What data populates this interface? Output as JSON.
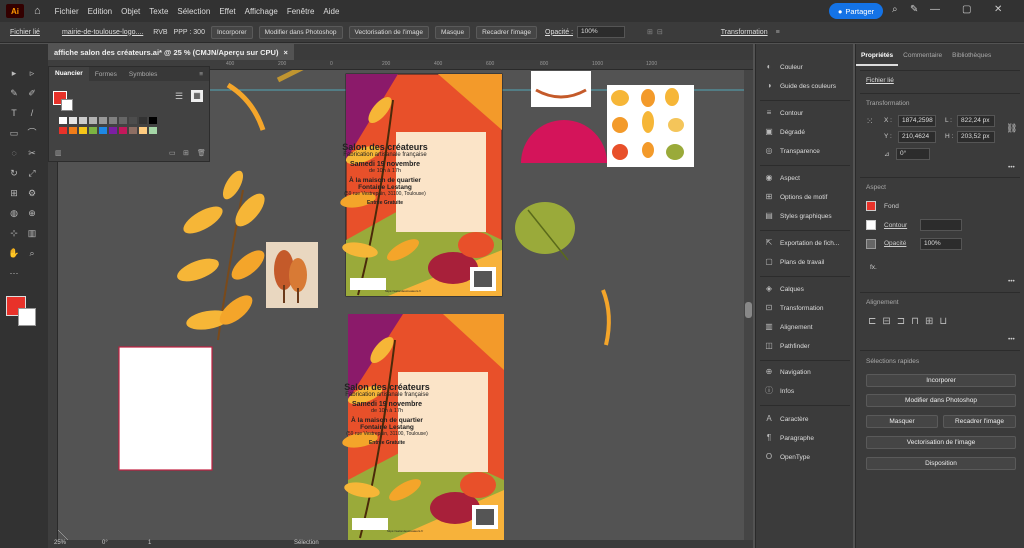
{
  "menubar": {
    "logo": "Ai",
    "items": [
      "Fichier",
      "Edition",
      "Objet",
      "Texte",
      "Sélection",
      "Effet",
      "Affichage",
      "Fenêtre",
      "Aide"
    ],
    "share_label": "Partager"
  },
  "controlbar": {
    "object_type": "Fichier lié",
    "file_name": "mairie-de-toulouse-logo....",
    "color_mode": "RVB",
    "ppi": "PPP : 300",
    "embed_label": "Incorporer",
    "edit_photoshop_label": "Modifier dans Photoshop",
    "vectorize_label": "Vectorisation de l'image",
    "mask_label": "Masque",
    "crop_label": "Recadrer l'image",
    "opacity_label": "Opacité :",
    "opacity_value": "100%",
    "transform_label": "Transformation"
  },
  "document_tab": {
    "title": "affiche salon des créateurs.ai* @ 25 % (CMJN/Aperçu sur CPU)",
    "close": "×"
  },
  "ruler": {
    "ticks": [
      "400",
      "200",
      "0",
      "200",
      "400",
      "600",
      "800",
      "1000",
      "1200"
    ]
  },
  "swatches_panel": {
    "tabs": [
      "Nuancier",
      "Formes",
      "Symboles"
    ],
    "colors": [
      "#ffffff",
      "#e5e5e5",
      "#cccccc",
      "#b3b3b3",
      "#999999",
      "#808080",
      "#666666",
      "#4d4d4d",
      "#333333",
      "#000000",
      "#e8322a",
      "#f07d1a",
      "#f5c518",
      "#7cb342",
      "#1e88e5",
      "#7b1fa2",
      "#c2185b",
      "#8d6e63",
      "#ffcc80",
      "#a5d6a7"
    ]
  },
  "poster": {
    "title": "Salon des créateurs",
    "subtitle": "Fabrication artisanale française",
    "date": "Samedi 19 novembre",
    "time": "de 10h à 17h",
    "venue": "À la maison de quartier Fontaine Lestang",
    "address": "(59 rue Vestrepain, 31100, Toulouse)",
    "entry": "Entrée Gratuite",
    "website": "https://salondescreateurs.fr"
  },
  "mid_panel": {
    "items": [
      "Couleur",
      "Guide des couleurs",
      "Contour",
      "Dégradé",
      "Transparence",
      "Aspect",
      "Options de motif",
      "Styles graphiques",
      "Exportation de fich...",
      "Plans de travail",
      "Calques",
      "Transformation",
      "Alignement",
      "Pathfinder",
      "Navigation",
      "Infos",
      "Caractère",
      "Paragraphe",
      "OpenType"
    ]
  },
  "properties": {
    "tabs": [
      "Propriétés",
      "Commentaire",
      "Bibliothèques"
    ],
    "object_type": "Fichier lié",
    "transform_title": "Transformation",
    "x_label": "X :",
    "x_value": "1874,2598",
    "y_label": "Y :",
    "y_value": "210,4624",
    "w_label": "L :",
    "w_value": "822,24 px",
    "h_label": "H :",
    "h_value": "203,52 px",
    "angle_value": "0°",
    "appearance_title": "Aspect",
    "fill_label": "Fond",
    "stroke_label": "Contour",
    "opacity_label": "Opacité",
    "opacity_value": "100%",
    "fx_label": "fx.",
    "align_title": "Alignement",
    "quick_title": "Sélections rapides",
    "btn_embed": "Incorporer",
    "btn_photoshop": "Modifier dans Photoshop",
    "btn_mask": "Masquer",
    "btn_crop": "Recadrer l'image",
    "btn_vectorize": "Vectorisation de l'image",
    "btn_arrange": "Disposition"
  },
  "statusbar": {
    "zoom": "25%",
    "angle": "0°",
    "page": "1",
    "tool": "Sélection"
  },
  "colors": {
    "fill": "#e8322a",
    "accent": "#1473e6"
  }
}
